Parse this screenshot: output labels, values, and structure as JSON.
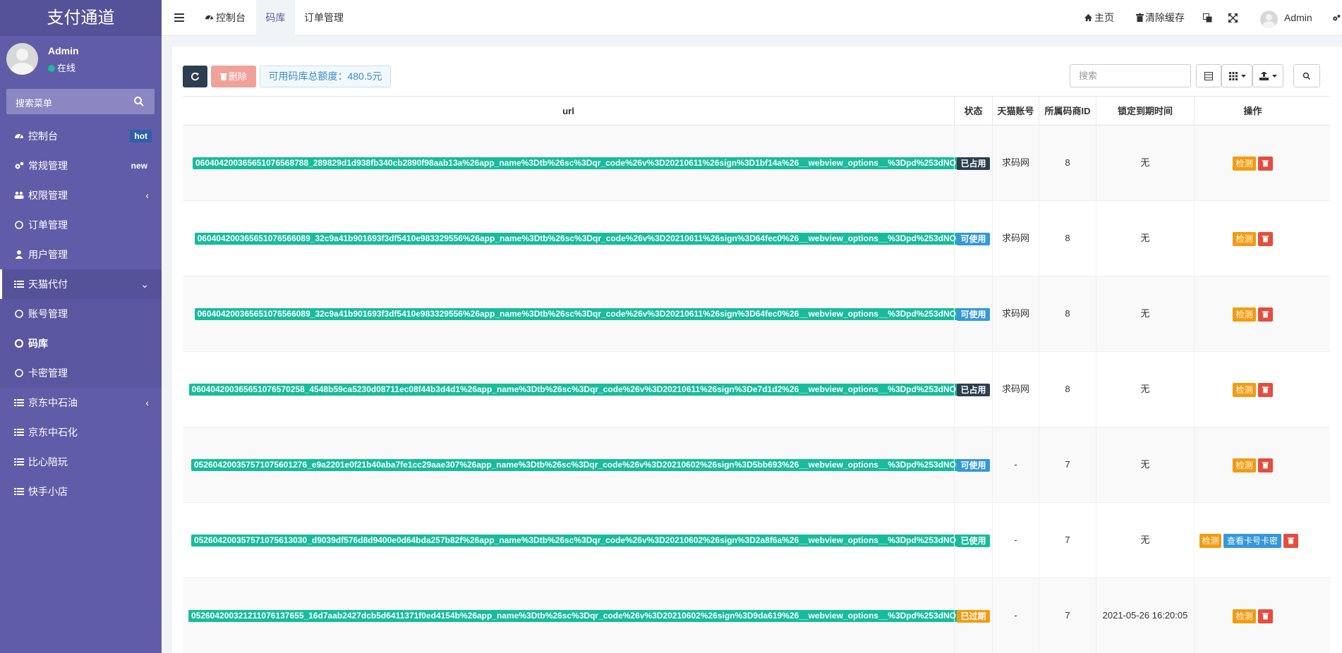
{
  "sidebar": {
    "logo": "支付通道",
    "user_name": "Admin",
    "user_status": "在线",
    "search_placeholder": "搜索菜单",
    "items": [
      {
        "label": "控制台",
        "icon": "dashboard-icon",
        "badge": "hot"
      },
      {
        "label": "常规管理",
        "icon": "cogs-icon",
        "badge": "new"
      },
      {
        "label": "权限管理",
        "icon": "group-icon",
        "chevron": "‹"
      },
      {
        "label": "订单管理",
        "icon": "circle-icon"
      },
      {
        "label": "用户管理",
        "icon": "user-icon"
      },
      {
        "label": "天猫代付",
        "icon": "list-icon",
        "chevron": "⌄"
      },
      {
        "label": "账号管理",
        "icon": "circle-icon"
      },
      {
        "label": "码库",
        "icon": "circle-icon"
      },
      {
        "label": "卡密管理",
        "icon": "circle-icon"
      },
      {
        "label": "京东中石油",
        "icon": "list-icon",
        "chevron": "‹"
      },
      {
        "label": "京东中石化",
        "icon": "list-icon"
      },
      {
        "label": "比心陪玩",
        "icon": "list-icon"
      },
      {
        "label": "快手小店",
        "icon": "list-icon"
      }
    ]
  },
  "topbar": {
    "tabs": [
      {
        "label": "控制台",
        "icon": "dashboard-icon"
      },
      {
        "label": "码库"
      },
      {
        "label": "订单管理"
      }
    ],
    "home_label": "主页",
    "clear_cache_label": "清除缓存",
    "admin_label": "Admin"
  },
  "toolbar": {
    "delete_label": "删除",
    "quota_label": "可用码库总额度：480.5元",
    "search_placeholder": "搜索"
  },
  "table": {
    "headers": {
      "url": "url",
      "status": "状态",
      "account": "天猫账号",
      "merchant_id": "所属码商ID",
      "lock_time": "锁定到期时间",
      "ops": "操作"
    },
    "rows": [
      {
        "url": "060404200365651076568788_289829d1d938fb340cb2890f98aab13a%26app_name%3Dtb%26sc%3Dqr_code%26v%3D20210611%26sign%3D1bf14a%26__webview_options__%3Dpd%253dNO",
        "status": "已占用",
        "status_color": "#2c3e50",
        "account": "求码网",
        "merchant_id": "8",
        "lock_time": "无",
        "view_label": ""
      },
      {
        "url": "060404200365651076566089_32c9a41b901693f3df5410e983329556%26app_name%3Dtb%26sc%3Dqr_code%26v%3D20210611%26sign%3D64fec0%26__webview_options__%3Dpd%253dNO",
        "status": "可使用",
        "status_color": "#3498db",
        "account": "求码网",
        "merchant_id": "8",
        "lock_time": "无",
        "view_label": ""
      },
      {
        "url": "060404200365651076566089_32c9a41b901693f3df5410e983329556%26app_name%3Dtb%26sc%3Dqr_code%26v%3D20210611%26sign%3D64fec0%26__webview_options__%3Dpd%253dNO",
        "status": "可使用",
        "status_color": "#3498db",
        "account": "求码网",
        "merchant_id": "8",
        "lock_time": "无",
        "view_label": ""
      },
      {
        "url": "060404200365651076570258_4548b59ca5230d08711ec08f44b3d4d1%26app_name%3Dtb%26sc%3Dqr_code%26v%3D20210611%26sign%3De7d1d2%26__webview_options__%3Dpd%253dNO",
        "status": "已占用",
        "status_color": "#2c3e50",
        "account": "求码网",
        "merchant_id": "8",
        "lock_time": "无",
        "view_label": ""
      },
      {
        "url": "052604200357571075601276_e9a2201e0f21b40aba7fe1cc29aae307%26app_name%3Dtb%26sc%3Dqr_code%26v%3D20210602%26sign%3D5bb693%26__webview_options__%3Dpd%253dNO",
        "status": "可使用",
        "status_color": "#3498db",
        "account": "-",
        "merchant_id": "7",
        "lock_time": "无",
        "view_label": ""
      },
      {
        "url": "052604200357571075613030_d9039df576d8d9400e0d64bda257b82f%26app_name%3Dtb%26sc%3Dqr_code%26v%3D20210602%26sign%3D2a8f6a%26__webview_options__%3Dpd%253dNO",
        "status": "已使用",
        "status_color": "#18bc9c",
        "account": "-",
        "merchant_id": "7",
        "lock_time": "无",
        "view_label": "查看卡号卡密"
      },
      {
        "url": "052604200321211076137655_16d7aab2427dcb5d6411371f0ed4154b%26app_name%3Dtb%26sc%3Dqr_code%26v%3D20210602%26sign%3D9da619%26__webview_options__%3Dpd%253dNO",
        "status": "已过期",
        "status_color": "#f39c12",
        "account": "-",
        "merchant_id": "7",
        "lock_time": "2021-05-26 16:20:05",
        "view_label": ""
      }
    ],
    "check_label": "检测"
  }
}
